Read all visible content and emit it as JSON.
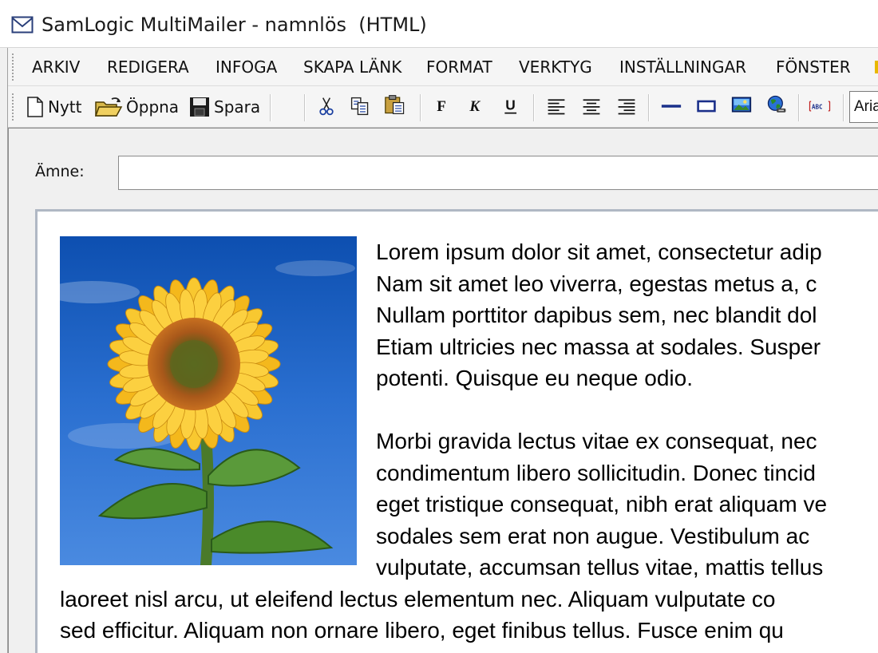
{
  "window": {
    "title": "SamLogic MultiMailer - namnlös  (HTML)"
  },
  "menu": {
    "items": [
      "ARKIV",
      "REDIGERA",
      "INFOGA",
      "SKAPA LÄNK",
      "FORMAT",
      "VERKTYG",
      "INSTÄLLNINGAR",
      "FÖNSTER"
    ]
  },
  "toolbar": {
    "new_label": "Nytt",
    "open_label": "Öppna",
    "save_label": "Spara",
    "font_value": "Arial",
    "icons": [
      "new-document-icon",
      "open-folder-icon",
      "save-disk-icon",
      "cut-icon",
      "copy-icon",
      "paste-icon",
      "bold-icon",
      "italic-icon",
      "underline-icon",
      "align-left-icon",
      "align-center-icon",
      "align-right-icon",
      "horizontal-line-icon",
      "rectangle-icon",
      "image-icon",
      "globe-link-icon",
      "spellcheck-icon"
    ]
  },
  "subject": {
    "label": "Ämne:",
    "value": ""
  },
  "editor": {
    "para1_lines": [
      "Lorem ipsum dolor sit amet, consectetur adip",
      "Nam sit amet leo viverra, egestas metus a, c",
      "Nullam porttitor dapibus sem, nec blandit dol",
      "Etiam ultricies nec massa at sodales. Susper",
      "potenti. Quisque eu neque odio."
    ],
    "para2_lines": [
      "Morbi gravida lectus vitae ex consequat, nec",
      "condimentum libero sollicitudin. Donec tincid",
      "eget tristique consequat, nibh erat aliquam ve",
      "sodales sem erat non augue. Vestibulum ac",
      "vulputate, accumsan tellus vitae, mattis tellus",
      "laoreet nisl arcu, ut eleifend lectus elementum nec. Aliquam vulputate co",
      "sed efficitur. Aliquam non ornare libero, eget finibus tellus. Fusce enim qu"
    ],
    "image_subject": "sunflower"
  },
  "colors": {
    "sky_blue": "#1f5fbf",
    "window_bg": "#f0f0f0",
    "accent_yellow": "#e8b800"
  }
}
